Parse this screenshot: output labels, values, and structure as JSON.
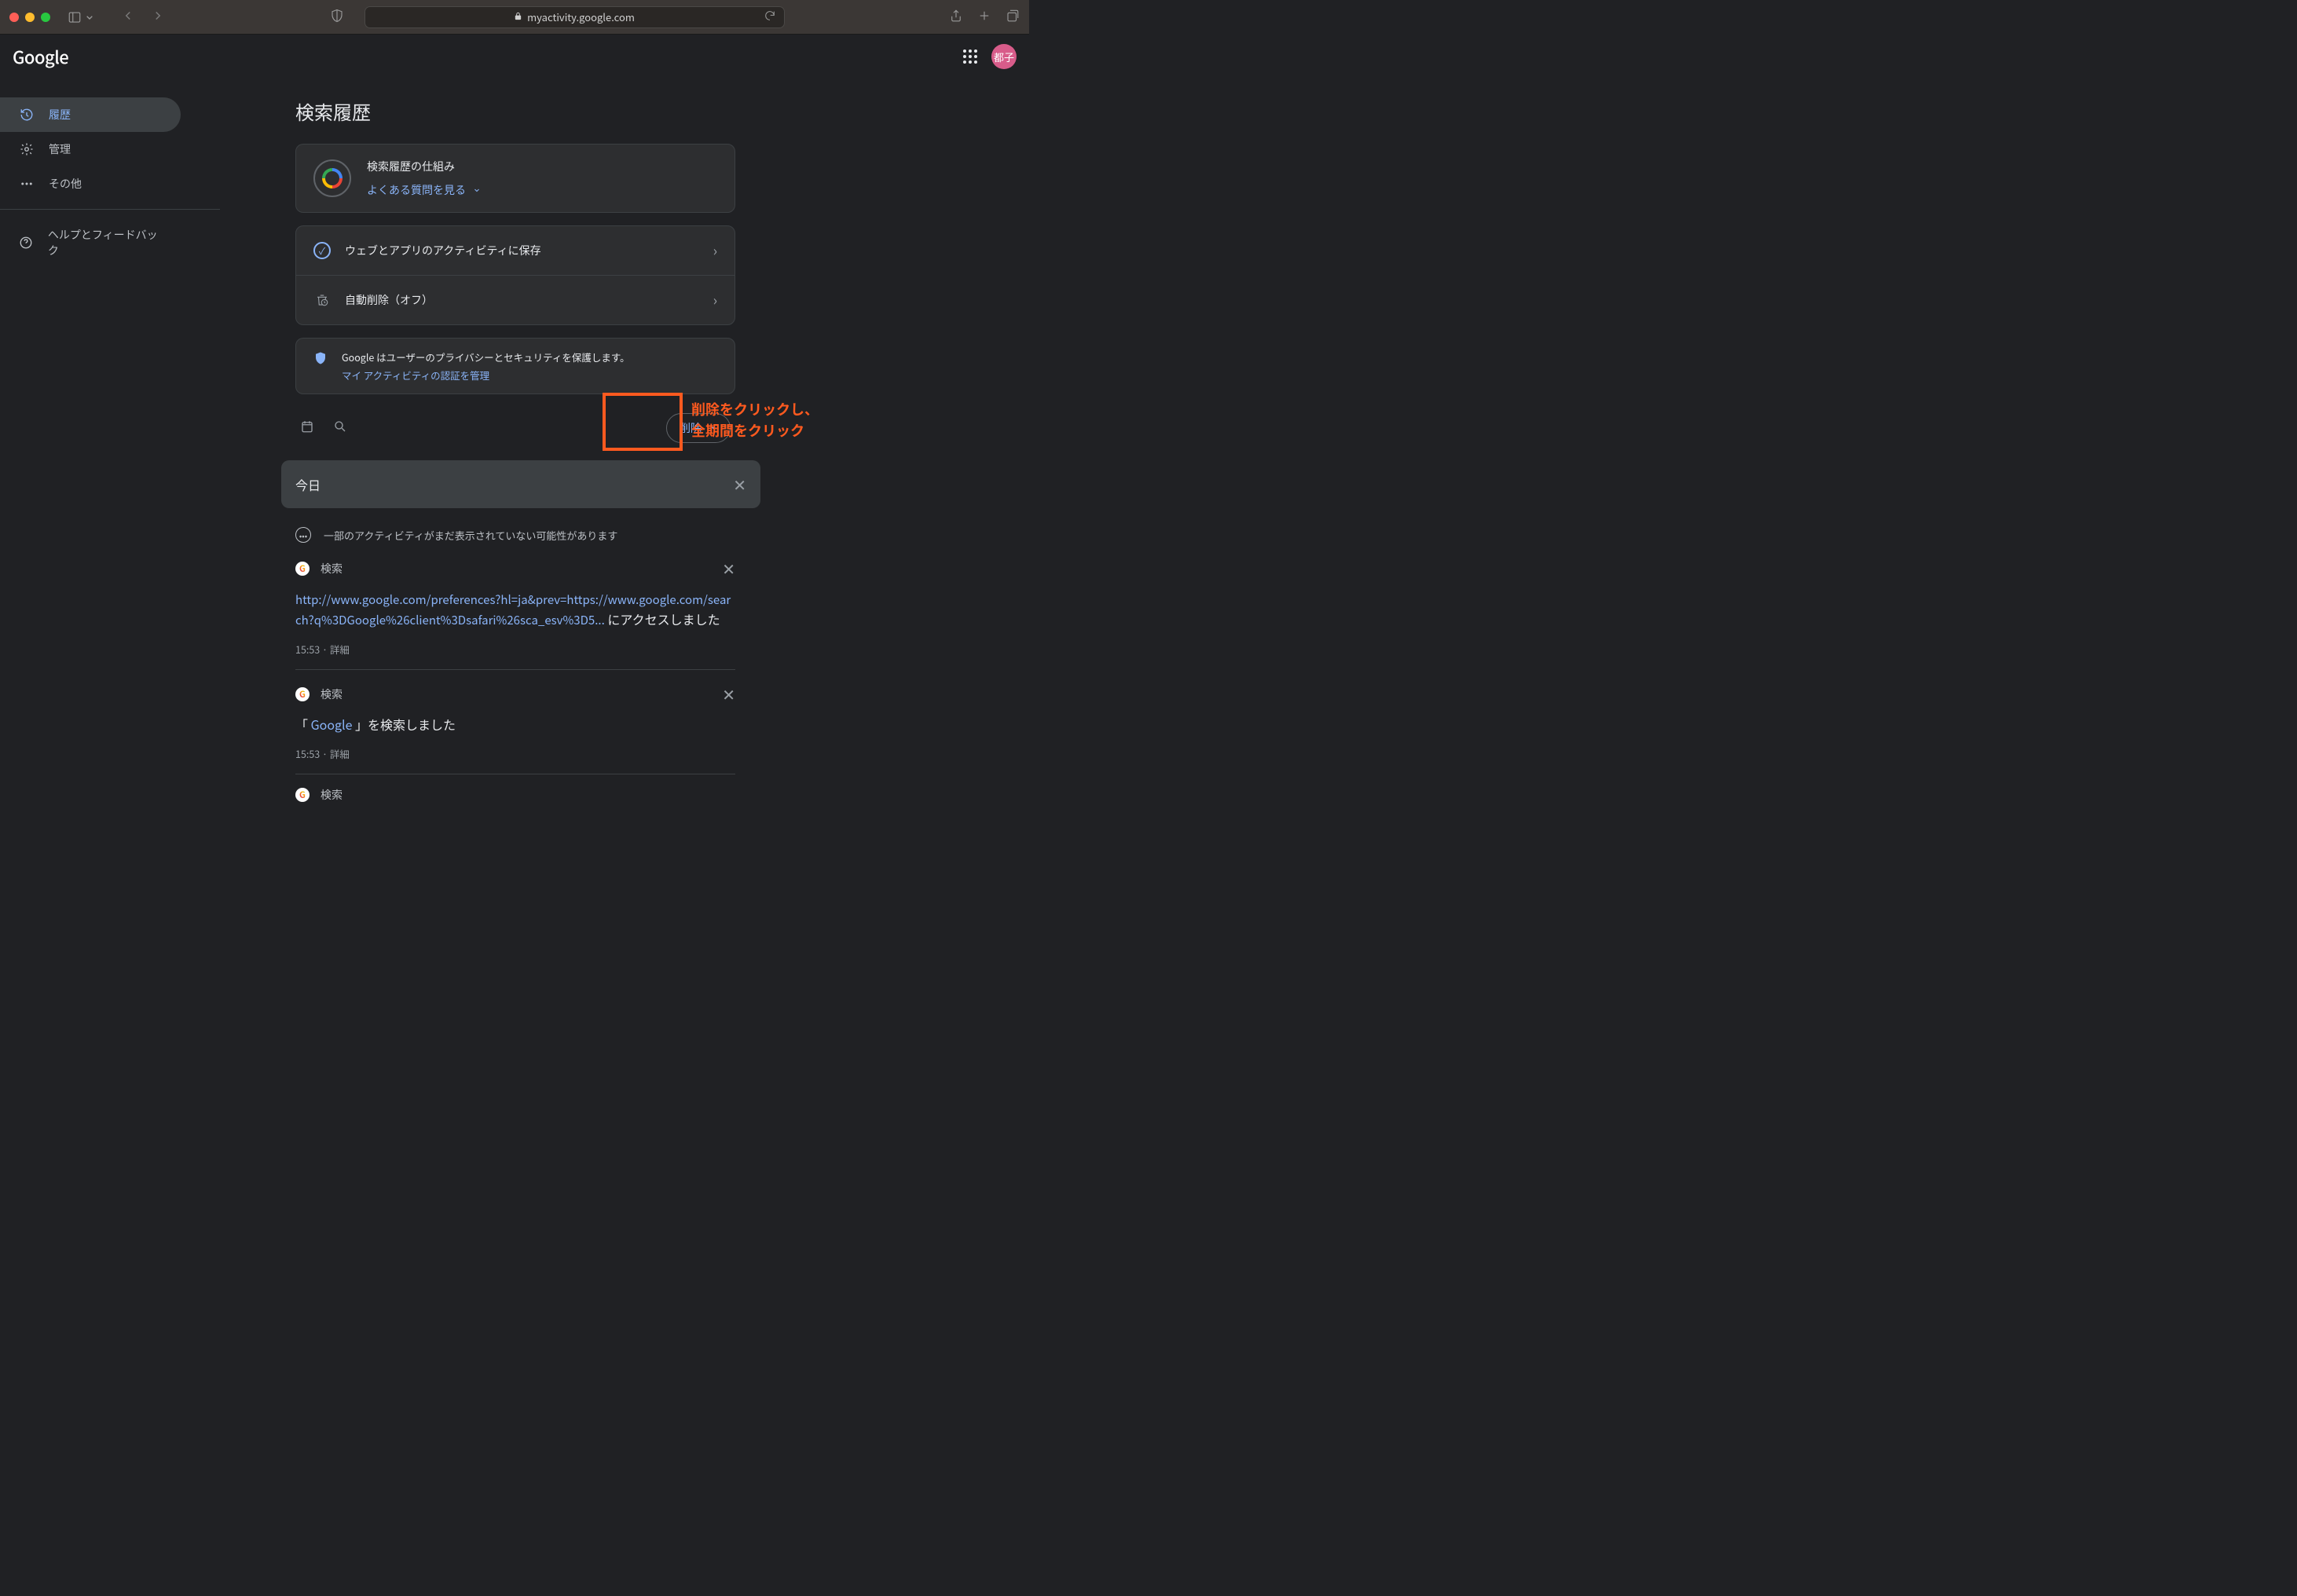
{
  "browser": {
    "url_display": "myactivity.google.com"
  },
  "header": {
    "logo": "Google",
    "avatar_text": "都子"
  },
  "sidebar": {
    "items": [
      {
        "label": "履歴",
        "icon": "history-icon",
        "active": true
      },
      {
        "label": "管理",
        "icon": "gear-icon",
        "active": false
      },
      {
        "label": "その他",
        "icon": "more-icon",
        "active": false
      }
    ],
    "help_label": "ヘルプとフィードバック"
  },
  "page": {
    "title": "検索履歴",
    "howitworks": {
      "title": "検索履歴の仕組み",
      "faq_link": "よくある質問を見る"
    },
    "settings": {
      "save_activity": "ウェブとアプリのアクティビティに保存",
      "auto_delete": "自動削除（オフ）"
    },
    "privacy": {
      "text": "Google はユーザーのプライバシーとセキュリティを保護します。",
      "manage_link": "マイ アクティビティの認証を管理"
    },
    "delete_button": "削除",
    "today_label": "今日",
    "notice_text": "一部のアクティビティがまだ表示されていない可能性があります"
  },
  "activities": [
    {
      "source": "検索",
      "link_text": "http://www.google.com/preferences?hl=ja&prev=https://www.google.com/search?q%3DGoogle%26client%3Dsafari%26sca_esv%3D5...",
      "suffix": " にアクセスしました",
      "time": "15:53",
      "detail_label": "詳細"
    },
    {
      "source": "検索",
      "search_term": "Google",
      "suffix": "を検索しました",
      "time": "15:53",
      "detail_label": "詳細"
    },
    {
      "source": "検索"
    }
  ],
  "annotation": {
    "line1": "削除をクリックし、",
    "line2": "全期間をクリック"
  }
}
